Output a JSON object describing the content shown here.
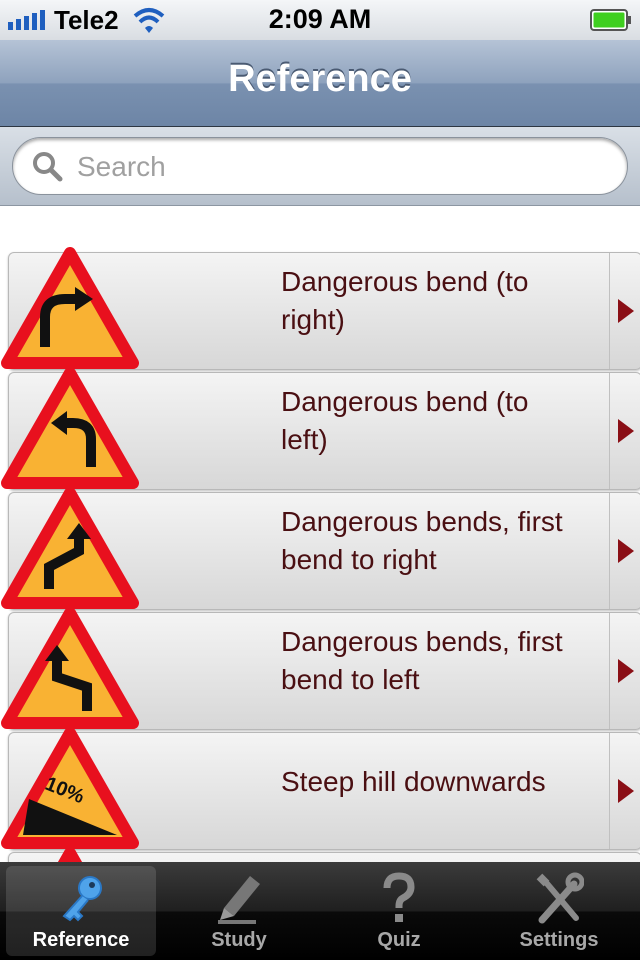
{
  "status_bar": {
    "carrier": "Tele2",
    "time": "2:09 AM"
  },
  "nav": {
    "title": "Reference"
  },
  "search": {
    "placeholder": "Search",
    "value": ""
  },
  "list": {
    "items": [
      {
        "label": "Dangerous bend (to right)",
        "icon": "dangerous-bend-right-sign"
      },
      {
        "label": "Dangerous bend (to left)",
        "icon": "dangerous-bend-left-sign"
      },
      {
        "label": "Dangerous bends, first bend to right",
        "icon": "dangerous-bends-right-first-sign"
      },
      {
        "label": "Dangerous bends, first bend to left",
        "icon": "dangerous-bends-left-first-sign"
      },
      {
        "label": "Steep hill downwards",
        "icon": "steep-hill-downwards-sign",
        "sign_text": "10%"
      }
    ]
  },
  "tabs": [
    {
      "label": "Reference",
      "icon": "key-icon",
      "active": true
    },
    {
      "label": "Study",
      "icon": "pencil-icon",
      "active": false
    },
    {
      "label": "Quiz",
      "icon": "question-mark-icon",
      "active": false
    },
    {
      "label": "Settings",
      "icon": "tools-icon",
      "active": false
    }
  ],
  "colors": {
    "sign_red": "#e8101e",
    "sign_yellow": "#f9b233",
    "label_text": "#4a0f12",
    "nav_blue": "#7a91b0"
  }
}
